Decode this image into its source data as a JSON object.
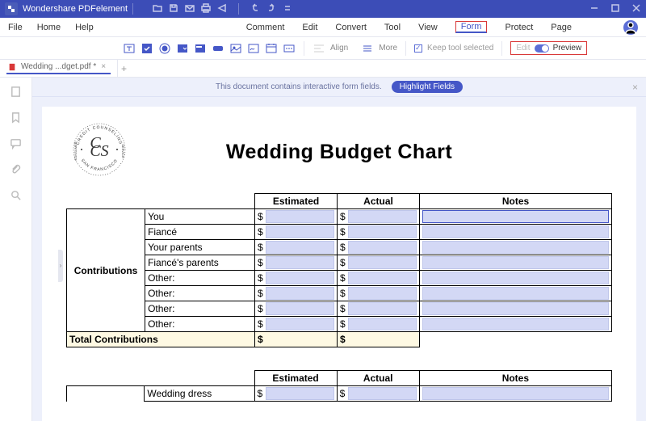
{
  "app": {
    "name": "Wondershare PDFelement"
  },
  "menu": {
    "file": "File",
    "home": "Home",
    "help": "Help",
    "comment": "Comment",
    "edit": "Edit",
    "convert": "Convert",
    "tool": "Tool",
    "view": "View",
    "form": "Form",
    "protect": "Protect",
    "page": "Page"
  },
  "toolbar": {
    "align": "Align",
    "more": "More",
    "keep": "Keep tool selected",
    "edit_lbl": "Edit",
    "preview": "Preview"
  },
  "filetab": {
    "name": "Wedding ...dget.pdf *"
  },
  "notice": {
    "text": "This document contains interactive form fields.",
    "button": "Highlight Fields"
  },
  "doc": {
    "title": "Wedding Budget Chart",
    "logo_top": "CREDIT COUNSELING",
    "logo_bottom": "SAN FRANCISCO",
    "logo_left": "CONSUMER",
    "logo_right": "SERVICE",
    "headers": {
      "estimated": "Estimated",
      "actual": "Actual",
      "notes": "Notes"
    },
    "section1": {
      "label": "Contributions",
      "rows": [
        "You",
        "Fiancé",
        "Your parents",
        "Fiancé's parents",
        "Other:",
        "Other:",
        "Other:",
        "Other:"
      ],
      "total": "Total Contributions"
    },
    "section2": {
      "rows": [
        "Wedding dress"
      ]
    },
    "dollar": "$"
  }
}
